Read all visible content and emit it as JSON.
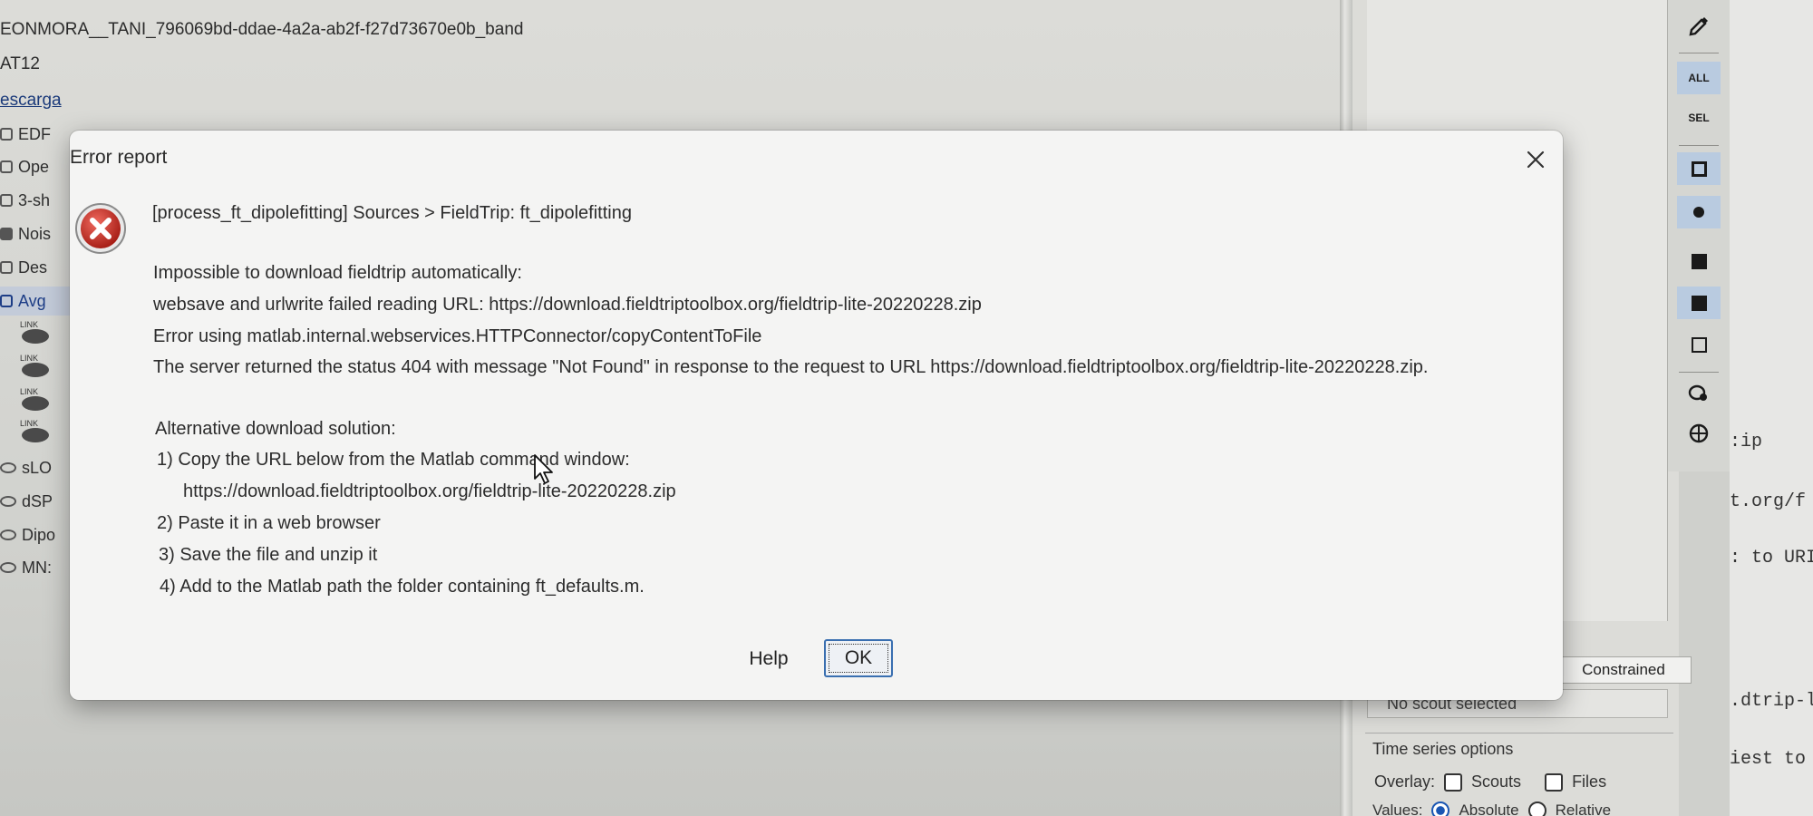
{
  "background_left": {
    "lines": [
      {
        "text": "EONMORA__TANI_796069bd-ddae-4a2a-ab2f-f27d73670e0b_band",
        "link": false
      },
      {
        "text": "AT12",
        "link": false
      },
      {
        "text": "escarga",
        "link": true
      }
    ],
    "tree_items": [
      {
        "label": "EDF"
      },
      {
        "label": "Ope"
      },
      {
        "label": "3-sh"
      },
      {
        "label": "Nois"
      },
      {
        "label": "Des"
      },
      {
        "label": "Avg"
      }
    ],
    "link_tag": "LINK",
    "scouts": [
      {
        "label": "sLO"
      },
      {
        "label": "dSP"
      },
      {
        "label": "Dipo"
      },
      {
        "label": "MN:"
      }
    ]
  },
  "toolbar": {
    "all_label": "ALL",
    "sel_label": "SEL"
  },
  "right_panel": {
    "constrained_label": "Constrained",
    "no_scout_text": "No scout selected",
    "timeseries_title": "Time series options",
    "overlay_label": "Overlay:",
    "scouts_option": "Scouts",
    "files_option": "Files",
    "values_label": "Values:",
    "absolute_option": "Absolute",
    "relative_option": "Relative"
  },
  "console": {
    "lines": [
      ":ip",
      "t.org/f",
      ": to URI",
      ".dtrip-l",
      "iest to"
    ]
  },
  "dialog": {
    "title": "Error report",
    "header": "[process_ft_dipolefitting]  Sources > FieldTrip: ft_dipolefitting",
    "message_lines": [
      "Impossible to download fieldtrip automatically:",
      "websave and urlwrite failed reading URL: https://download.fieldtriptoolbox.org/fieldtrip-lite-20220228.zip",
      "Error using matlab.internal.webservices.HTTPConnector/copyContentToFile",
      "The server returned the status 404 with message \"Not Found\" in response to the request to URL https://download.fieldtriptoolbox.org/fieldtrip-lite-20220228.zip."
    ],
    "alt_lines": [
      "Alternative download solution:",
      "1) Copy the URL below from the Matlab command window:",
      "https://download.fieldtriptoolbox.org/fieldtrip-lite-20220228.zip",
      "2) Paste it in a web browser",
      "3) Save the file and unzip it",
      "4) Add to the Matlab path the folder containing ft_defaults.m."
    ],
    "help_label": "Help",
    "ok_label": "OK"
  },
  "colors": {
    "error_red": "#c62828",
    "ok_border": "#3a6fb0"
  }
}
